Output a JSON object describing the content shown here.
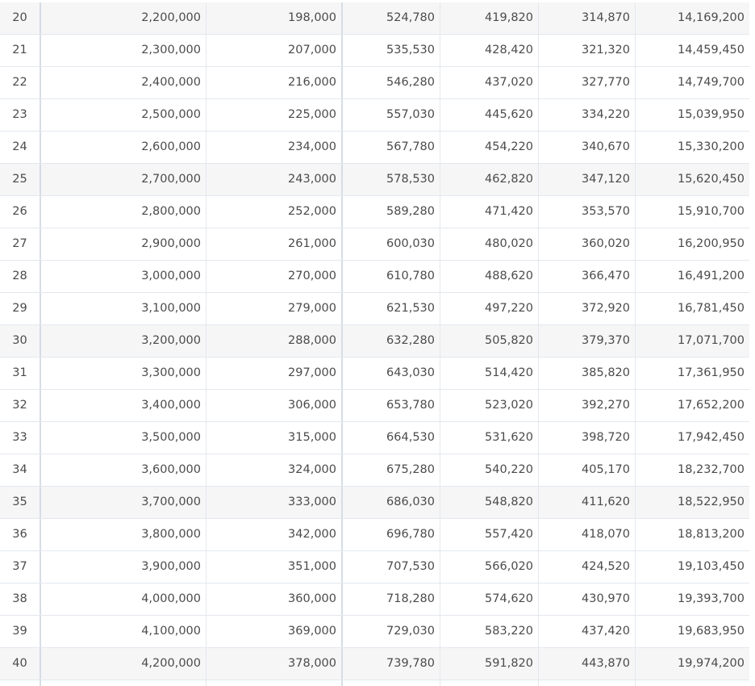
{
  "table": {
    "rows": [
      {
        "no": "20",
        "c1": "2,200,000",
        "c2": "198,000",
        "c3": "524,780",
        "c4": "419,820",
        "c5": "314,870",
        "c6": "14,169,200",
        "shaded": true
      },
      {
        "no": "21",
        "c1": "2,300,000",
        "c2": "207,000",
        "c3": "535,530",
        "c4": "428,420",
        "c5": "321,320",
        "c6": "14,459,450",
        "shaded": false
      },
      {
        "no": "22",
        "c1": "2,400,000",
        "c2": "216,000",
        "c3": "546,280",
        "c4": "437,020",
        "c5": "327,770",
        "c6": "14,749,700",
        "shaded": false
      },
      {
        "no": "23",
        "c1": "2,500,000",
        "c2": "225,000",
        "c3": "557,030",
        "c4": "445,620",
        "c5": "334,220",
        "c6": "15,039,950",
        "shaded": false
      },
      {
        "no": "24",
        "c1": "2,600,000",
        "c2": "234,000",
        "c3": "567,780",
        "c4": "454,220",
        "c5": "340,670",
        "c6": "15,330,200",
        "shaded": false
      },
      {
        "no": "25",
        "c1": "2,700,000",
        "c2": "243,000",
        "c3": "578,530",
        "c4": "462,820",
        "c5": "347,120",
        "c6": "15,620,450",
        "shaded": true
      },
      {
        "no": "26",
        "c1": "2,800,000",
        "c2": "252,000",
        "c3": "589,280",
        "c4": "471,420",
        "c5": "353,570",
        "c6": "15,910,700",
        "shaded": false
      },
      {
        "no": "27",
        "c1": "2,900,000",
        "c2": "261,000",
        "c3": "600,030",
        "c4": "480,020",
        "c5": "360,020",
        "c6": "16,200,950",
        "shaded": false
      },
      {
        "no": "28",
        "c1": "3,000,000",
        "c2": "270,000",
        "c3": "610,780",
        "c4": "488,620",
        "c5": "366,470",
        "c6": "16,491,200",
        "shaded": false
      },
      {
        "no": "29",
        "c1": "3,100,000",
        "c2": "279,000",
        "c3": "621,530",
        "c4": "497,220",
        "c5": "372,920",
        "c6": "16,781,450",
        "shaded": false
      },
      {
        "no": "30",
        "c1": "3,200,000",
        "c2": "288,000",
        "c3": "632,280",
        "c4": "505,820",
        "c5": "379,370",
        "c6": "17,071,700",
        "shaded": true
      },
      {
        "no": "31",
        "c1": "3,300,000",
        "c2": "297,000",
        "c3": "643,030",
        "c4": "514,420",
        "c5": "385,820",
        "c6": "17,361,950",
        "shaded": false
      },
      {
        "no": "32",
        "c1": "3,400,000",
        "c2": "306,000",
        "c3": "653,780",
        "c4": "523,020",
        "c5": "392,270",
        "c6": "17,652,200",
        "shaded": false
      },
      {
        "no": "33",
        "c1": "3,500,000",
        "c2": "315,000",
        "c3": "664,530",
        "c4": "531,620",
        "c5": "398,720",
        "c6": "17,942,450",
        "shaded": false
      },
      {
        "no": "34",
        "c1": "3,600,000",
        "c2": "324,000",
        "c3": "675,280",
        "c4": "540,220",
        "c5": "405,170",
        "c6": "18,232,700",
        "shaded": false
      },
      {
        "no": "35",
        "c1": "3,700,000",
        "c2": "333,000",
        "c3": "686,030",
        "c4": "548,820",
        "c5": "411,620",
        "c6": "18,522,950",
        "shaded": true
      },
      {
        "no": "36",
        "c1": "3,800,000",
        "c2": "342,000",
        "c3": "696,780",
        "c4": "557,420",
        "c5": "418,070",
        "c6": "18,813,200",
        "shaded": false
      },
      {
        "no": "37",
        "c1": "3,900,000",
        "c2": "351,000",
        "c3": "707,530",
        "c4": "566,020",
        "c5": "424,520",
        "c6": "19,103,450",
        "shaded": false
      },
      {
        "no": "38",
        "c1": "4,000,000",
        "c2": "360,000",
        "c3": "718,280",
        "c4": "574,620",
        "c5": "430,970",
        "c6": "19,393,700",
        "shaded": false
      },
      {
        "no": "39",
        "c1": "4,100,000",
        "c2": "369,000",
        "c3": "729,030",
        "c4": "583,220",
        "c5": "437,420",
        "c6": "19,683,950",
        "shaded": false
      },
      {
        "no": "40",
        "c1": "4,200,000",
        "c2": "378,000",
        "c3": "739,780",
        "c4": "591,820",
        "c5": "443,870",
        "c6": "19,974,200",
        "shaded": true
      }
    ]
  },
  "colors": {
    "row_shaded": "#f6f6f7",
    "grid_line": "#e3e8ee",
    "text": "#4b4b4b"
  }
}
